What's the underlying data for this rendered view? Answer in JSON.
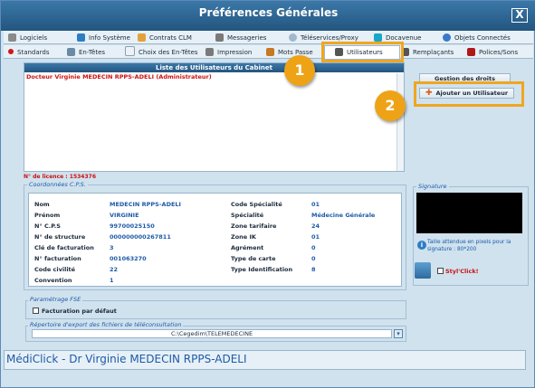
{
  "window": {
    "title": "Préférences Générales",
    "close_label": "X"
  },
  "tabs_row1": [
    {
      "label": "Logiciels",
      "icon": "wrench-icon"
    },
    {
      "label": "Info Système",
      "icon": "info-icon"
    },
    {
      "label": "Contrats CLM",
      "icon": "pencil-icon"
    },
    {
      "label": "Messageries",
      "icon": "mail-icon"
    },
    {
      "label": "Téléservices/Proxy",
      "icon": "globe-icon"
    },
    {
      "label": "Docavenue",
      "icon": "docavenue-icon"
    },
    {
      "label": "Objets Connectés",
      "icon": "wireless-icon"
    }
  ],
  "tabs_row2": [
    {
      "label": "Standards",
      "icon": "dot-icon"
    },
    {
      "label": "En-Têtes",
      "icon": "header-icon"
    },
    {
      "label": "Choix des En-Têtes",
      "icon": "doc-icon"
    },
    {
      "label": "Impression",
      "icon": "printer-icon"
    },
    {
      "label": "Mots Passe",
      "icon": "key-icon"
    },
    {
      "label": "Utilisateurs",
      "icon": "user-icon"
    },
    {
      "label": "Remplaçants",
      "icon": "users-icon"
    },
    {
      "label": "Polices/Sons",
      "icon": "font-icon"
    }
  ],
  "users_panel": {
    "header": "Liste des Utilisateurs du Cabinet",
    "users": [
      "Docteur Virginie MEDECIN RPPS-ADELI (Administrateur)"
    ]
  },
  "license": "N° de licence : 1534376",
  "rights": {
    "header": "Gestion des droits",
    "add_user_label": "Ajouter un Utilisateur"
  },
  "callouts": [
    "1",
    "2"
  ],
  "cps": {
    "legend": "Coordonnées C.P.S.",
    "left": [
      {
        "label": "Nom",
        "value": "MEDECIN RPPS-ADELI"
      },
      {
        "label": "Prénom",
        "value": "VIRGINIE"
      },
      {
        "label": "N° C.P.S",
        "value": "99700025150"
      },
      {
        "label": "N° de structure",
        "value": "000000000267811"
      },
      {
        "label": "Clé de facturation",
        "value": "3"
      },
      {
        "label": "N° facturation",
        "value": "001063270"
      },
      {
        "label": "Code civilité",
        "value": "22"
      },
      {
        "label": "Convention",
        "value": "1"
      }
    ],
    "right": [
      {
        "label": "Code Spécialité",
        "value": "01"
      },
      {
        "label": "Spécialité",
        "value": "Médecine Générale"
      },
      {
        "label": "Zone tarifaire",
        "value": "24"
      },
      {
        "label": "Zone IK",
        "value": "01"
      },
      {
        "label": "Agrément",
        "value": "0"
      },
      {
        "label": "Type de carte",
        "value": "0"
      },
      {
        "label": "Type Identification",
        "value": "8"
      }
    ]
  },
  "signature": {
    "legend": "Signature",
    "info": "Taille attendue en pixels pour la signature : 80*200",
    "styl_label": "Styl'Click!"
  },
  "fse": {
    "legend": "Paramétrage FSE",
    "checkbox_label": "Facturation par défaut"
  },
  "export": {
    "legend": "Répertoire d'export des fichiers de téléconsultation",
    "path": "C:\\Cegedim\\TELEMEDECINE"
  },
  "status_bar": "MédiClick - Dr Virginie MEDECIN RPPS-ADELI",
  "colors": {
    "accent": "#23557f",
    "highlight": "#f0a61f",
    "value_blue": "#1e5aa8",
    "user_red": "#cc1111"
  }
}
